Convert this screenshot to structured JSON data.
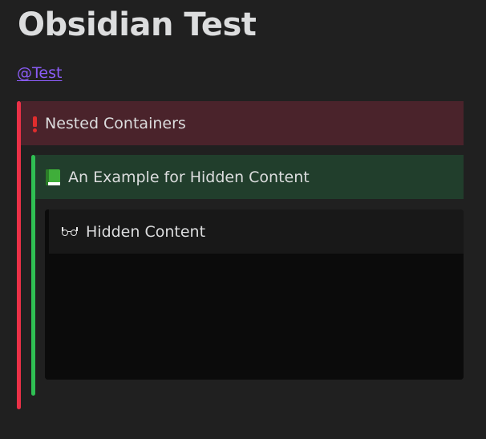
{
  "document": {
    "title": "Obsidian Test",
    "tag": "@Test"
  },
  "callouts": {
    "outer": {
      "icon": "exclamation-icon",
      "title": "Nested Containers",
      "accent_color": "#e93147",
      "header_bg": "#4a232b"
    },
    "middle": {
      "icon": "green-book-icon",
      "title": "An Example for Hidden Content",
      "accent_color": "#2fbf53",
      "header_bg": "#213e2c"
    },
    "inner": {
      "icon": "glasses-icon",
      "title": "Hidden Content",
      "header_bg": "#181818",
      "body_bg": "#0b0b0b",
      "content": ""
    }
  },
  "theme": {
    "background": "#202020",
    "text": "#dcddde",
    "link": "#8a5cf5"
  }
}
